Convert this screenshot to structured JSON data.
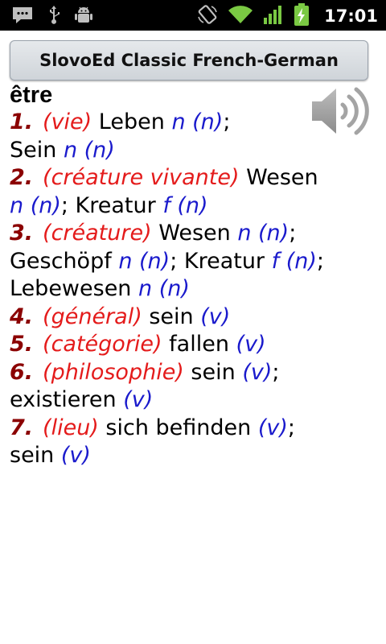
{
  "status_bar": {
    "time": "17:01",
    "icons": [
      "messages-icon",
      "usb-icon",
      "android-debug-icon",
      "rotation-icon",
      "wifi-icon",
      "signal-icon",
      "battery-charging-icon"
    ]
  },
  "app": {
    "title": "SlovoEd Classic French-German"
  },
  "entry": {
    "headword": "être",
    "lines": [
      {
        "num": "1.",
        "label": "(vie)",
        "t1": " Leben ",
        "g1": "n (n)",
        "p1": ";"
      },
      {
        "t1": "Sein ",
        "g1": "n (n)"
      },
      {
        "num": "2.",
        "label": "(créature vivante)",
        "t1": " Wesen"
      },
      {
        "g1": "n (n)",
        "t1": "; Kreatur ",
        "g2": "f (n)"
      },
      {
        "num": "3.",
        "label": "(créature)",
        "t1": " Wesen ",
        "g1": "n (n)",
        "p1": ";"
      },
      {
        "t1": "Geschöpf ",
        "g1": "n (n)",
        "t2": "; Kreatur ",
        "g2": "f (n)",
        "p1": ";"
      },
      {
        "t1": "Lebewesen ",
        "g1": "n (n)"
      },
      {
        "num": "4.",
        "label": "(général)",
        "t1": " sein ",
        "g1": "(v)"
      },
      {
        "num": "5.",
        "label": "(catégorie)",
        "t1": " fallen ",
        "g1": "(v)"
      },
      {
        "num": "6.",
        "label": "(philosophie)",
        "t1": " sein ",
        "g1": "(v)",
        "p1": ";"
      },
      {
        "t1": "existieren ",
        "g1": "(v)"
      },
      {
        "num": "7.",
        "label": "(lieu)",
        "t1": " sich befinden ",
        "g1": "(v)",
        "p1": ";"
      },
      {
        "t1": "sein ",
        "g1": "(v)"
      }
    ]
  },
  "colors": {
    "sense_number": "#8b0000",
    "label": "#e41b1b",
    "grammar": "#1a1acc",
    "translation": "#000000"
  }
}
